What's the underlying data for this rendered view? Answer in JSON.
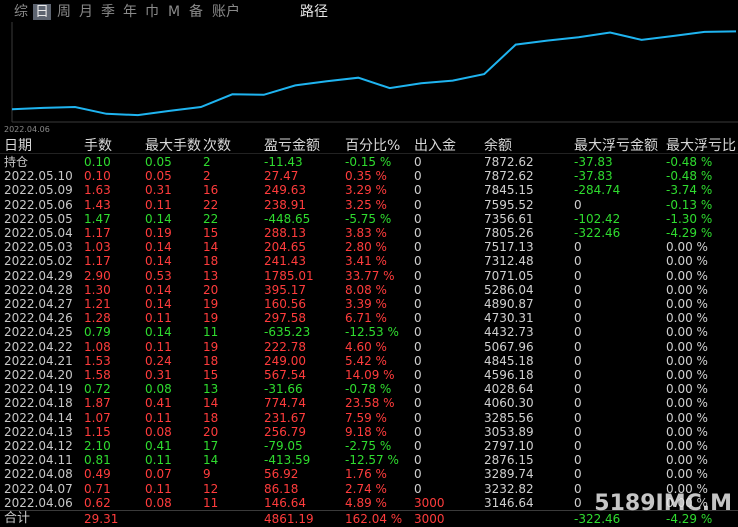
{
  "tabs": [
    "综",
    "日",
    "周",
    "月",
    "季",
    "年",
    "巾",
    "M",
    "备",
    "账户"
  ],
  "active_tab": "日",
  "route_label": "路径",
  "chart": {
    "start_date": "2022.04.06",
    "line_color": "#1fb4f0",
    "series_balance": [
      3146.64,
      3232.82,
      3289.74,
      2876.15,
      2797.1,
      3053.89,
      3285.56,
      4060.3,
      4028.64,
      4596.18,
      4845.18,
      5067.96,
      4432.73,
      4730.31,
      4890.87,
      5286.04,
      7071.05,
      7312.48,
      7517.13,
      7805.26,
      7356.61,
      7595.52,
      7845.15,
      7872.62
    ],
    "ylim": [
      2500,
      8200
    ]
  },
  "table": {
    "headers": [
      "日期",
      "手数",
      "最大手数",
      "次数",
      "盈亏金额",
      "百分比%",
      "出入金",
      "余额",
      "最大浮亏金额",
      "最大浮亏比"
    ],
    "rows": [
      {
        "date": "持仓",
        "lots": "0.10",
        "max_lots": "0.05",
        "count": "2",
        "pnl": "-11.43",
        "pct": "-0.15 %",
        "io": "0",
        "bal": "7872.62",
        "mfl": "-37.83",
        "mflp": "-0.48 %",
        "color": "dn"
      },
      {
        "date": "2022.05.10",
        "lots": "0.10",
        "max_lots": "0.05",
        "count": "2",
        "pnl": "27.47",
        "pct": "0.35 %",
        "io": "0",
        "bal": "7872.62",
        "mfl": "-37.83",
        "mflp": "-0.48 %",
        "color": "up"
      },
      {
        "date": "2022.05.09",
        "lots": "1.63",
        "max_lots": "0.31",
        "count": "16",
        "pnl": "249.63",
        "pct": "3.29 %",
        "io": "0",
        "bal": "7845.15",
        "mfl": "-284.74",
        "mflp": "-3.74 %",
        "color": "up"
      },
      {
        "date": "2022.05.06",
        "lots": "1.43",
        "max_lots": "0.11",
        "count": "22",
        "pnl": "238.91",
        "pct": "3.25 %",
        "io": "0",
        "bal": "7595.52",
        "mfl": "0",
        "mflp": "-0.13 %",
        "color": "up"
      },
      {
        "date": "2022.05.05",
        "lots": "1.47",
        "max_lots": "0.14",
        "count": "22",
        "pnl": "-448.65",
        "pct": "-5.75 %",
        "io": "0",
        "bal": "7356.61",
        "mfl": "-102.42",
        "mflp": "-1.30 %",
        "color": "dn"
      },
      {
        "date": "2022.05.04",
        "lots": "1.17",
        "max_lots": "0.19",
        "count": "15",
        "pnl": "288.13",
        "pct": "3.83 %",
        "io": "0",
        "bal": "7805.26",
        "mfl": "-322.46",
        "mflp": "-4.29 %",
        "color": "up"
      },
      {
        "date": "2022.05.03",
        "lots": "1.03",
        "max_lots": "0.14",
        "count": "14",
        "pnl": "204.65",
        "pct": "2.80 %",
        "io": "0",
        "bal": "7517.13",
        "mfl": "0",
        "mflp": "0.00 %",
        "color": "up"
      },
      {
        "date": "2022.05.02",
        "lots": "1.17",
        "max_lots": "0.14",
        "count": "18",
        "pnl": "241.43",
        "pct": "3.41 %",
        "io": "0",
        "bal": "7312.48",
        "mfl": "0",
        "mflp": "0.00 %",
        "color": "up"
      },
      {
        "date": "2022.04.29",
        "lots": "2.90",
        "max_lots": "0.53",
        "count": "13",
        "pnl": "1785.01",
        "pct": "33.77 %",
        "io": "0",
        "bal": "7071.05",
        "mfl": "0",
        "mflp": "0.00 %",
        "color": "up"
      },
      {
        "date": "2022.04.28",
        "lots": "1.30",
        "max_lots": "0.14",
        "count": "20",
        "pnl": "395.17",
        "pct": "8.08 %",
        "io": "0",
        "bal": "5286.04",
        "mfl": "0",
        "mflp": "0.00 %",
        "color": "up"
      },
      {
        "date": "2022.04.27",
        "lots": "1.21",
        "max_lots": "0.14",
        "count": "19",
        "pnl": "160.56",
        "pct": "3.39 %",
        "io": "0",
        "bal": "4890.87",
        "mfl": "0",
        "mflp": "0.00 %",
        "color": "up"
      },
      {
        "date": "2022.04.26",
        "lots": "1.28",
        "max_lots": "0.11",
        "count": "19",
        "pnl": "297.58",
        "pct": "6.71 %",
        "io": "0",
        "bal": "4730.31",
        "mfl": "0",
        "mflp": "0.00 %",
        "color": "up"
      },
      {
        "date": "2022.04.25",
        "lots": "0.79",
        "max_lots": "0.14",
        "count": "11",
        "pnl": "-635.23",
        "pct": "-12.53 %",
        "io": "0",
        "bal": "4432.73",
        "mfl": "0",
        "mflp": "0.00 %",
        "color": "dn"
      },
      {
        "date": "2022.04.22",
        "lots": "1.08",
        "max_lots": "0.11",
        "count": "19",
        "pnl": "222.78",
        "pct": "4.60 %",
        "io": "0",
        "bal": "5067.96",
        "mfl": "0",
        "mflp": "0.00 %",
        "color": "up"
      },
      {
        "date": "2022.04.21",
        "lots": "1.53",
        "max_lots": "0.24",
        "count": "18",
        "pnl": "249.00",
        "pct": "5.42 %",
        "io": "0",
        "bal": "4845.18",
        "mfl": "0",
        "mflp": "0.00 %",
        "color": "up"
      },
      {
        "date": "2022.04.20",
        "lots": "1.58",
        "max_lots": "0.31",
        "count": "15",
        "pnl": "567.54",
        "pct": "14.09 %",
        "io": "0",
        "bal": "4596.18",
        "mfl": "0",
        "mflp": "0.00 %",
        "color": "up"
      },
      {
        "date": "2022.04.19",
        "lots": "0.72",
        "max_lots": "0.08",
        "count": "13",
        "pnl": "-31.66",
        "pct": "-0.78 %",
        "io": "0",
        "bal": "4028.64",
        "mfl": "0",
        "mflp": "0.00 %",
        "color": "dn"
      },
      {
        "date": "2022.04.18",
        "lots": "1.87",
        "max_lots": "0.41",
        "count": "14",
        "pnl": "774.74",
        "pct": "23.58 %",
        "io": "0",
        "bal": "4060.30",
        "mfl": "0",
        "mflp": "0.00 %",
        "color": "up"
      },
      {
        "date": "2022.04.14",
        "lots": "1.07",
        "max_lots": "0.11",
        "count": "18",
        "pnl": "231.67",
        "pct": "7.59 %",
        "io": "0",
        "bal": "3285.56",
        "mfl": "0",
        "mflp": "0.00 %",
        "color": "up"
      },
      {
        "date": "2022.04.13",
        "lots": "1.15",
        "max_lots": "0.08",
        "count": "20",
        "pnl": "256.79",
        "pct": "9.18 %",
        "io": "0",
        "bal": "3053.89",
        "mfl": "0",
        "mflp": "0.00 %",
        "color": "up"
      },
      {
        "date": "2022.04.12",
        "lots": "2.10",
        "max_lots": "0.41",
        "count": "17",
        "pnl": "-79.05",
        "pct": "-2.75 %",
        "io": "0",
        "bal": "2797.10",
        "mfl": "0",
        "mflp": "0.00 %",
        "color": "dn"
      },
      {
        "date": "2022.04.11",
        "lots": "0.81",
        "max_lots": "0.11",
        "count": "14",
        "pnl": "-413.59",
        "pct": "-12.57 %",
        "io": "0",
        "bal": "2876.15",
        "mfl": "0",
        "mflp": "0.00 %",
        "color": "dn"
      },
      {
        "date": "2022.04.08",
        "lots": "0.49",
        "max_lots": "0.07",
        "count": "9",
        "pnl": "56.92",
        "pct": "1.76 %",
        "io": "0",
        "bal": "3289.74",
        "mfl": "0",
        "mflp": "0.00 %",
        "color": "up"
      },
      {
        "date": "2022.04.07",
        "lots": "0.71",
        "max_lots": "0.11",
        "count": "12",
        "pnl": "86.18",
        "pct": "2.74 %",
        "io": "0",
        "bal": "3232.82",
        "mfl": "0",
        "mflp": "0.00 %",
        "color": "up"
      },
      {
        "date": "2022.04.06",
        "lots": "0.62",
        "max_lots": "0.08",
        "count": "11",
        "pnl": "146.64",
        "pct": "4.89 %",
        "io": "3000",
        "bal": "3146.64",
        "mfl": "0",
        "mflp": "0.00 %",
        "color": "up"
      }
    ],
    "total": {
      "date": "合计",
      "lots": "29.31",
      "max_lots": "",
      "count": "",
      "pnl": "4861.19",
      "pct": "162.04 %",
      "io": "3000",
      "bal": "",
      "mfl": "-322.46",
      "mflp": "-4.29 %",
      "color": "up"
    }
  },
  "watermark": "5189IMC.M"
}
